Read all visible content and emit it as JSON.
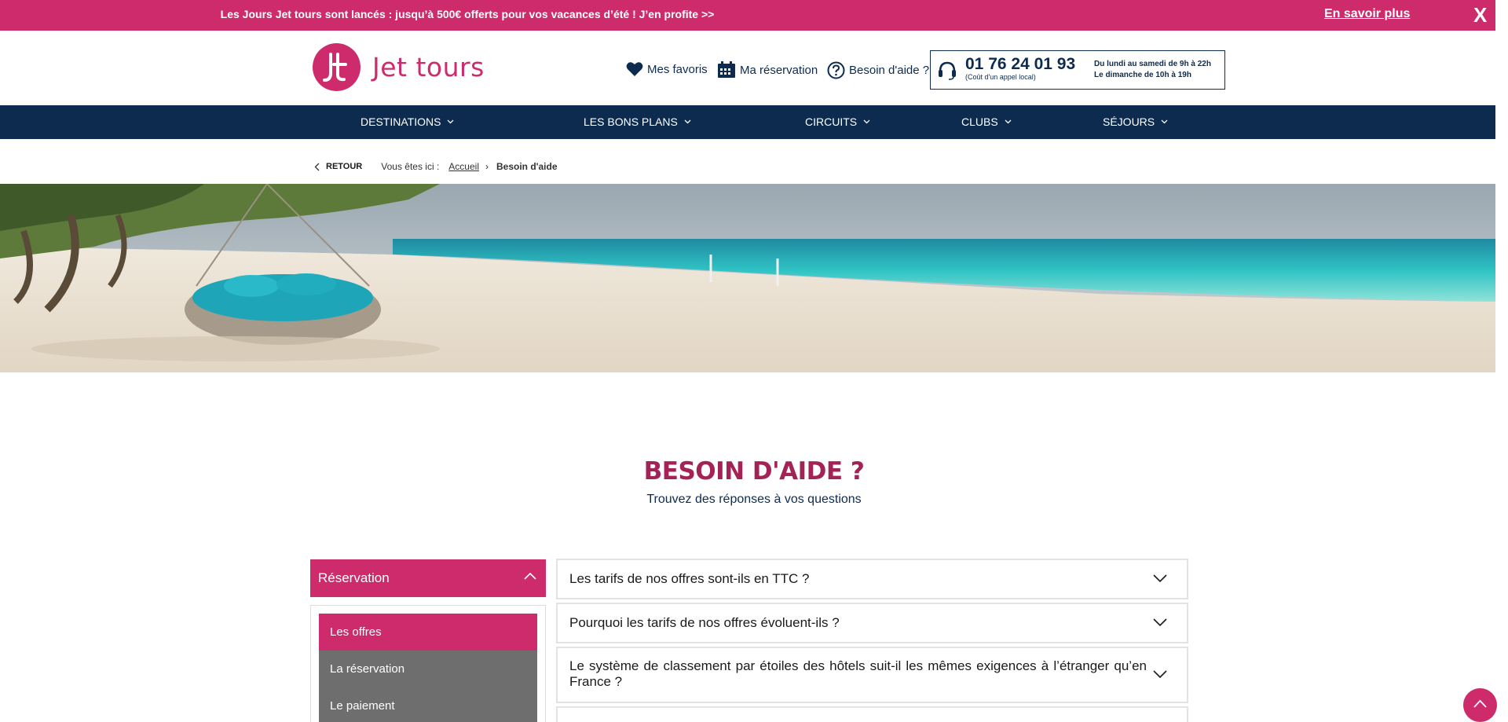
{
  "promo": {
    "text": "Les Jours Jet tours sont lancés : jusqu’à 500€ offerts pour vos vacances d’été ! J’en profite >>",
    "link": "En savoir plus",
    "close": "X"
  },
  "header": {
    "logo_text": "Jet tours",
    "favorites": "Mes favoris",
    "reservation": "Ma réservation",
    "help": "Besoin d'aide ?",
    "phone": "01 76 24 01 93",
    "phone_cost": "(Coût d'un appel local)",
    "hours_week": "Du lundi au samedi de 9h à 22h",
    "hours_sunday": "Le dimanche de 10h à 19h"
  },
  "nav": {
    "items": [
      "DESTINATIONS",
      "LES BONS PLANS",
      "CIRCUITS",
      "CLUBS",
      "SÉJOURS"
    ]
  },
  "breadcrumb": {
    "back": "RETOUR",
    "here": "Vous êtes ici :",
    "home": "Accueil",
    "sep": "›",
    "current": "Besoin d'aide"
  },
  "page": {
    "title": "BESOIN D'AIDE ?",
    "subtitle": "Trouvez des réponses à vos questions"
  },
  "sidebar": {
    "category": "Réservation",
    "items": [
      "Les offres",
      "La réservation",
      "Le paiement"
    ]
  },
  "faq": {
    "questions": [
      "Les tarifs de nos offres sont-ils en TTC ?",
      "Pourquoi les tarifs de nos offres évoluent-ils ?",
      "Le système de classement par étoiles des hôtels suit-il les mêmes exigences à l’étranger qu’en France ?"
    ]
  },
  "colors": {
    "brand_pink": "#cd2b6b",
    "navy": "#0d2b4e",
    "title": "#a32357"
  }
}
